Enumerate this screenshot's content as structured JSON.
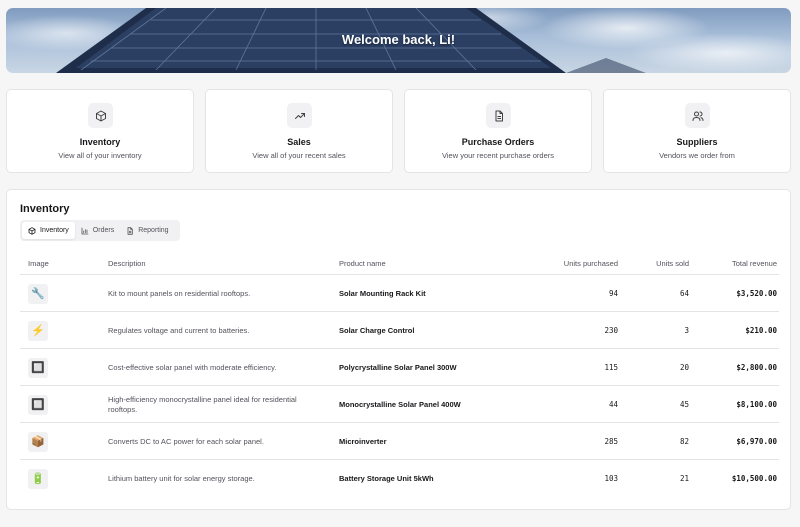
{
  "hero": {
    "title": "Welcome back, Li!"
  },
  "cards": [
    {
      "icon": "box-icon",
      "title": "Inventory",
      "subtitle": "View all of your inventory"
    },
    {
      "icon": "trending-up-icon",
      "title": "Sales",
      "subtitle": "View all of your recent sales"
    },
    {
      "icon": "document-icon",
      "title": "Purchase Orders",
      "subtitle": "View your recent purchase orders"
    },
    {
      "icon": "users-icon",
      "title": "Suppliers",
      "subtitle": "Vendors we order from"
    }
  ],
  "panel": {
    "title": "Inventory",
    "tabs": [
      {
        "label": "Inventory",
        "icon": "box-icon",
        "active": true
      },
      {
        "label": "Orders",
        "icon": "bar-chart-icon",
        "active": false
      },
      {
        "label": "Reporting",
        "icon": "document-icon",
        "active": false
      }
    ]
  },
  "table": {
    "columns": [
      "Image",
      "Description",
      "Product name",
      "Units purchased",
      "Units sold",
      "Total revenue"
    ],
    "rows": [
      {
        "image": "🔧",
        "image_name": "wrench-icon",
        "description": "Kit to mount panels on residential rooftops.",
        "product": "Solar Mounting Rack Kit",
        "purchased": "94",
        "sold": "64",
        "revenue": "$3,520.00"
      },
      {
        "image": "⚡",
        "image_name": "lightning-icon",
        "description": "Regulates voltage and current to batteries.",
        "product": "Solar Charge Control",
        "purchased": "230",
        "sold": "3",
        "revenue": "$210.00"
      },
      {
        "image": "🔲",
        "image_name": "panel-icon",
        "description": "Cost-effective solar panel with moderate efficiency.",
        "product": "Polycrystalline Solar Panel 300W",
        "purchased": "115",
        "sold": "20",
        "revenue": "$2,800.00"
      },
      {
        "image": "🔲",
        "image_name": "panel-icon",
        "description": "High-efficiency monocrystalline panel ideal for residential rooftops.",
        "product": "Monocrystalline Solar Panel 400W",
        "purchased": "44",
        "sold": "45",
        "revenue": "$8,100.00"
      },
      {
        "image": "📦",
        "image_name": "package-icon",
        "description": "Converts DC to AC power for each solar panel.",
        "product": "Microinverter",
        "purchased": "285",
        "sold": "82",
        "revenue": "$6,970.00"
      },
      {
        "image": "🔋",
        "image_name": "battery-icon",
        "description": "Lithium battery unit for solar energy storage.",
        "product": "Battery Storage Unit 5kWh",
        "purchased": "103",
        "sold": "21",
        "revenue": "$10,500.00"
      }
    ]
  }
}
